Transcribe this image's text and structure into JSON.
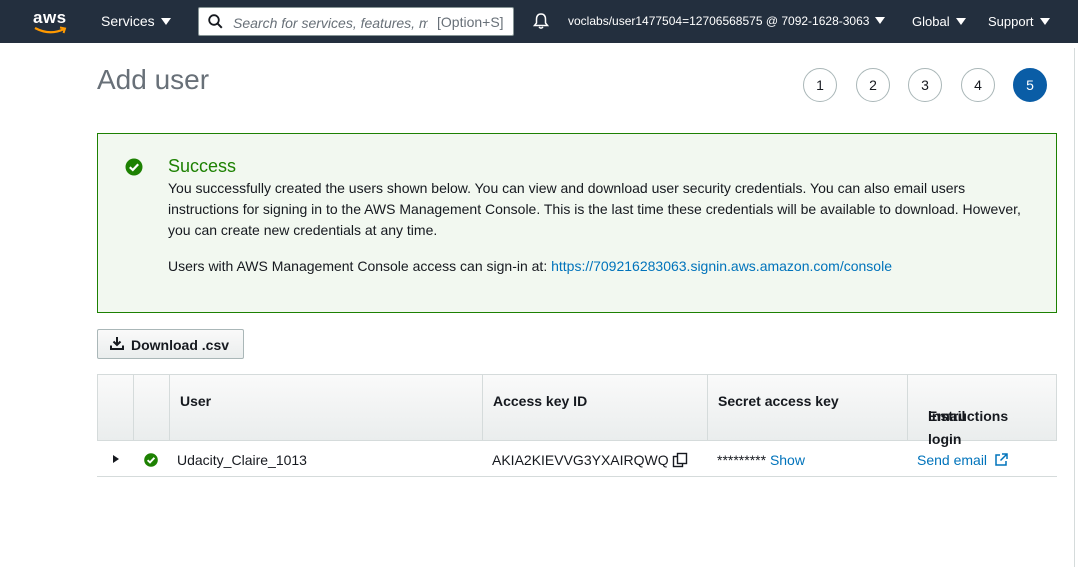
{
  "nav": {
    "logo": "aws",
    "services_label": "Services",
    "search_placeholder": "Search for services, features, marketplace products, and docs",
    "search_shortcut": "[Option+S]",
    "account_label": "voclabs/user1477504=12706568575 @ 7092-1628-3063",
    "region_label": "Global",
    "support_label": "Support"
  },
  "page": {
    "title": "Add user",
    "steps": [
      "1",
      "2",
      "3",
      "4",
      "5"
    ],
    "active_step": "5"
  },
  "success": {
    "title": "Success",
    "message": "You successfully created the users shown below. You can view and download user security credentials. You can also email users instructions for signing in to the AWS Management Console. This is the last time these credentials will be available to download. However, you can create new credentials at any time.",
    "signin_prefix": "Users with AWS Management Console access can sign-in at: ",
    "signin_url": "https://709216283063.signin.aws.amazon.com/console"
  },
  "download_label": "Download .csv",
  "table": {
    "headers": {
      "user": "User",
      "access_key_id": "Access key ID",
      "secret_access_key": "Secret access key",
      "email_login_line1": "Email login",
      "email_login_line2": "instructions"
    },
    "rows": [
      {
        "user": "Udacity_Claire_1013",
        "access_key_id": "AKIA2KIEVVG3YXAIRQWQ",
        "secret_masked": "*********",
        "show_label": "Show",
        "send_email_label": "Send email"
      }
    ]
  },
  "colors": {
    "nav_bg": "#232f3e",
    "success_green": "#1d8102",
    "success_bg": "#f2f8f0",
    "link_blue": "#0073bb",
    "active_step": "#0a5da6"
  }
}
